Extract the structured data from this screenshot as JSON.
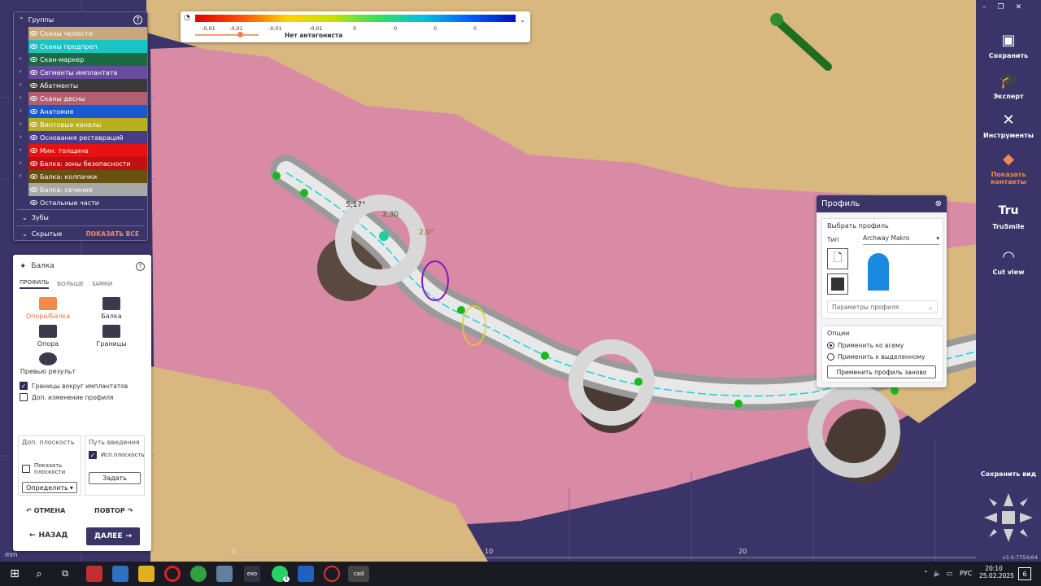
{
  "groups": {
    "title": "Группы",
    "items": [
      {
        "label": "Сканы челюсти",
        "color": "#c8a87a",
        "arrow": false,
        "eye": true
      },
      {
        "label": "Сканы предпреп",
        "color": "#1bc4c4",
        "arrow": false,
        "eye": true
      },
      {
        "label": "Скан-маркер",
        "color": "#1a6a44",
        "arrow": true,
        "eye": true
      },
      {
        "label": "Сегменты имплантата",
        "color": "#6a4aa0",
        "arrow": true,
        "eye": true
      },
      {
        "label": "Абатменты",
        "color": "#3a3a3a",
        "arrow": true,
        "eye": true
      },
      {
        "label": "Сканы десны",
        "color": "#b06070",
        "arrow": true,
        "eye": true
      },
      {
        "label": "Анатомия",
        "color": "#1a5acc",
        "arrow": true,
        "eye": true
      },
      {
        "label": "Винтовые каналы",
        "color": "#b8b020",
        "arrow": true,
        "eye": true
      },
      {
        "label": "Основания реставраций",
        "color": "#4a3a8a",
        "arrow": true,
        "eye": true
      },
      {
        "label": "Мин. толщина",
        "color": "#e81010",
        "arrow": true,
        "eye": true
      },
      {
        "label": "Балка: зоны безопасности",
        "color": "#c01010",
        "arrow": true,
        "eye": true
      },
      {
        "label": "Балка: колпачки",
        "color": "#6a5010",
        "arrow": true,
        "eye": true
      },
      {
        "label": "Балка: сечение",
        "color": "#a8a8a8",
        "arrow": false,
        "eye": true
      },
      {
        "label": "Остальные части",
        "color": "#3b3468",
        "arrow": false,
        "eye": true
      }
    ],
    "teeth": "Зубы",
    "hidden": "Скрытые",
    "show_all": "ПОКАЗАТЬ ВСЕ"
  },
  "balka": {
    "title": "Балка",
    "tabs": [
      "ПРОФИЛЬ",
      "БОЛЬШЕ",
      "ЗАМКИ"
    ],
    "tools": [
      "Опора/Балка",
      "Балка",
      "Опора",
      "Границы",
      "Превью результ"
    ],
    "chk_implant": "Границы вокруг имплантатов",
    "chk_profile": "Доп. изменение профиля",
    "plane_title": "Доп. плоскость",
    "show_planes": "Показать плоскости",
    "define": "Определить",
    "path_title": "Путь введения",
    "use_plane": "Исп.плоскость",
    "set": "Задать",
    "cancel": "ОТМЕНА",
    "redo": "ПОВТОР",
    "back": "НАЗАД",
    "next": "ДАЛЕЕ"
  },
  "legend": {
    "ticks": [
      "-0,01",
      "-0,01",
      "-0,01",
      "-0,01",
      "0",
      "0",
      "0",
      "0"
    ],
    "label": "Нет антагониста"
  },
  "profil": {
    "title": "Профиль",
    "select": "Выбрать профиль",
    "type_label": "Тип",
    "type_value": "Archway Makro",
    "params": "Параметры профиля",
    "options": "Опции",
    "apply_all": "Применить ко всему",
    "apply_sel": "Применить к выделенному",
    "reapply": "Применить профиль заново"
  },
  "rightbar": {
    "save": "Сохранить",
    "expert": "Эксперт",
    "tools": "Инструменты",
    "contacts": "Показать контакты",
    "trusmile": "TruSmile",
    "trusmile_logo": "Tru",
    "cutview": "Cut view",
    "saveview": "Сохранить вид",
    "version": "v3.0-7754/64",
    "accent": "#f08a50"
  },
  "scene": {
    "measure1": "5,17°",
    "measure2": "2,30",
    "measure3": "2,0°",
    "mm": "mm",
    "axis": [
      "0",
      "10",
      "20"
    ]
  },
  "taskbar": {
    "time": "20:10",
    "date": "25.02.2025",
    "lang": "РУС",
    "notif": "6",
    "app_exo": "exo",
    "app_cad": "cad",
    "wa_badge": "3"
  }
}
